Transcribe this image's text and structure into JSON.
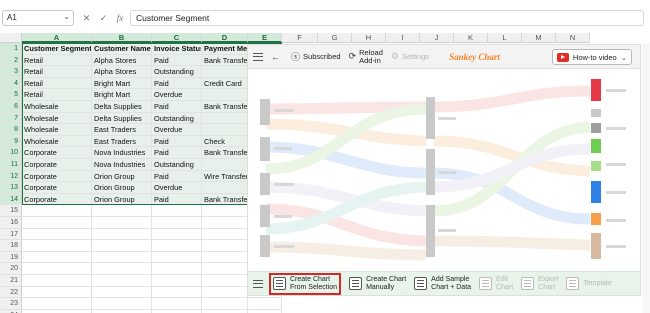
{
  "formula_bar": {
    "name_box": "A1",
    "fx_label": "fx",
    "cancel_glyph": "✕",
    "confirm_glyph": "✓",
    "content": "Customer Segment"
  },
  "columns": [
    "A",
    "B",
    "C",
    "D",
    "E",
    "F",
    "G",
    "H",
    "I",
    "J",
    "K",
    "L",
    "M",
    "N"
  ],
  "rows": [
    "1",
    "2",
    "3",
    "4",
    "5",
    "6",
    "7",
    "8",
    "9",
    "10",
    "11",
    "12",
    "13",
    "14",
    "15",
    "16",
    "17",
    "18",
    "19",
    "20",
    "21",
    "22",
    "23",
    "24"
  ],
  "table": {
    "headers": [
      "Customer Segment",
      "Customer Name",
      "Invoice Status",
      "Payment Met"
    ],
    "rows": [
      [
        "Retail",
        "Alpha Stores",
        "Paid",
        "Bank Transfer"
      ],
      [
        "Retail",
        "Alpha Stores",
        "Outstanding",
        ""
      ],
      [
        "Retail",
        "Bright Mart",
        "Paid",
        "Credit Card"
      ],
      [
        "Retail",
        "Bright Mart",
        "Overdue",
        ""
      ],
      [
        "Wholesale",
        "Delta Supplies",
        "Paid",
        "Bank Transfer"
      ],
      [
        "Wholesale",
        "Delta Supplies",
        "Outstanding",
        ""
      ],
      [
        "Wholesale",
        "East Traders",
        "Overdue",
        ""
      ],
      [
        "Wholesale",
        "East Traders",
        "Paid",
        "Check"
      ],
      [
        "Corporate",
        "Nova Industries",
        "Paid",
        "Bank Transfer"
      ],
      [
        "Corporate",
        "Nova Industries",
        "Outstanding",
        ""
      ],
      [
        "Corporate",
        "Orion Group",
        "Paid",
        "Wire Transfer"
      ],
      [
        "Corporate",
        "Orion Group",
        "Overdue",
        ""
      ],
      [
        "Corporate",
        "Orion Group",
        "Paid",
        "Bank Transfer"
      ]
    ]
  },
  "panel": {
    "toolbar": {
      "subscribed_label": "Subscribed",
      "reload_line1": "Reload",
      "reload_line2": "Add-in",
      "settings_label": "Settings",
      "title": "Sankey Chart",
      "howto_label": "How-to video"
    },
    "bottom": {
      "create_selection_l1": "Create Chart",
      "create_selection_l2": "From Selection",
      "create_manual_l1": "Create Chart",
      "create_manual_l2": "Manually",
      "add_sample_l1": "Add Sample",
      "add_sample_l2": "Chart + Data",
      "edit_l1": "Edit",
      "edit_l2": "Chart",
      "export_l1": "Export",
      "export_l2": "Chart",
      "template_label": "Template"
    },
    "icons": {
      "menu": "hamburger-icon",
      "back": "arrow-left-icon",
      "subscribed": "dollar-circle-icon",
      "reload": "refresh-icon",
      "settings": "gear-icon",
      "youtube": "youtube-icon"
    }
  },
  "colors": {
    "excel_green": "#217346",
    "selection_fill": "#e7f1e9",
    "title_orange": "#f4832a",
    "highlight_red": "#d62828"
  }
}
